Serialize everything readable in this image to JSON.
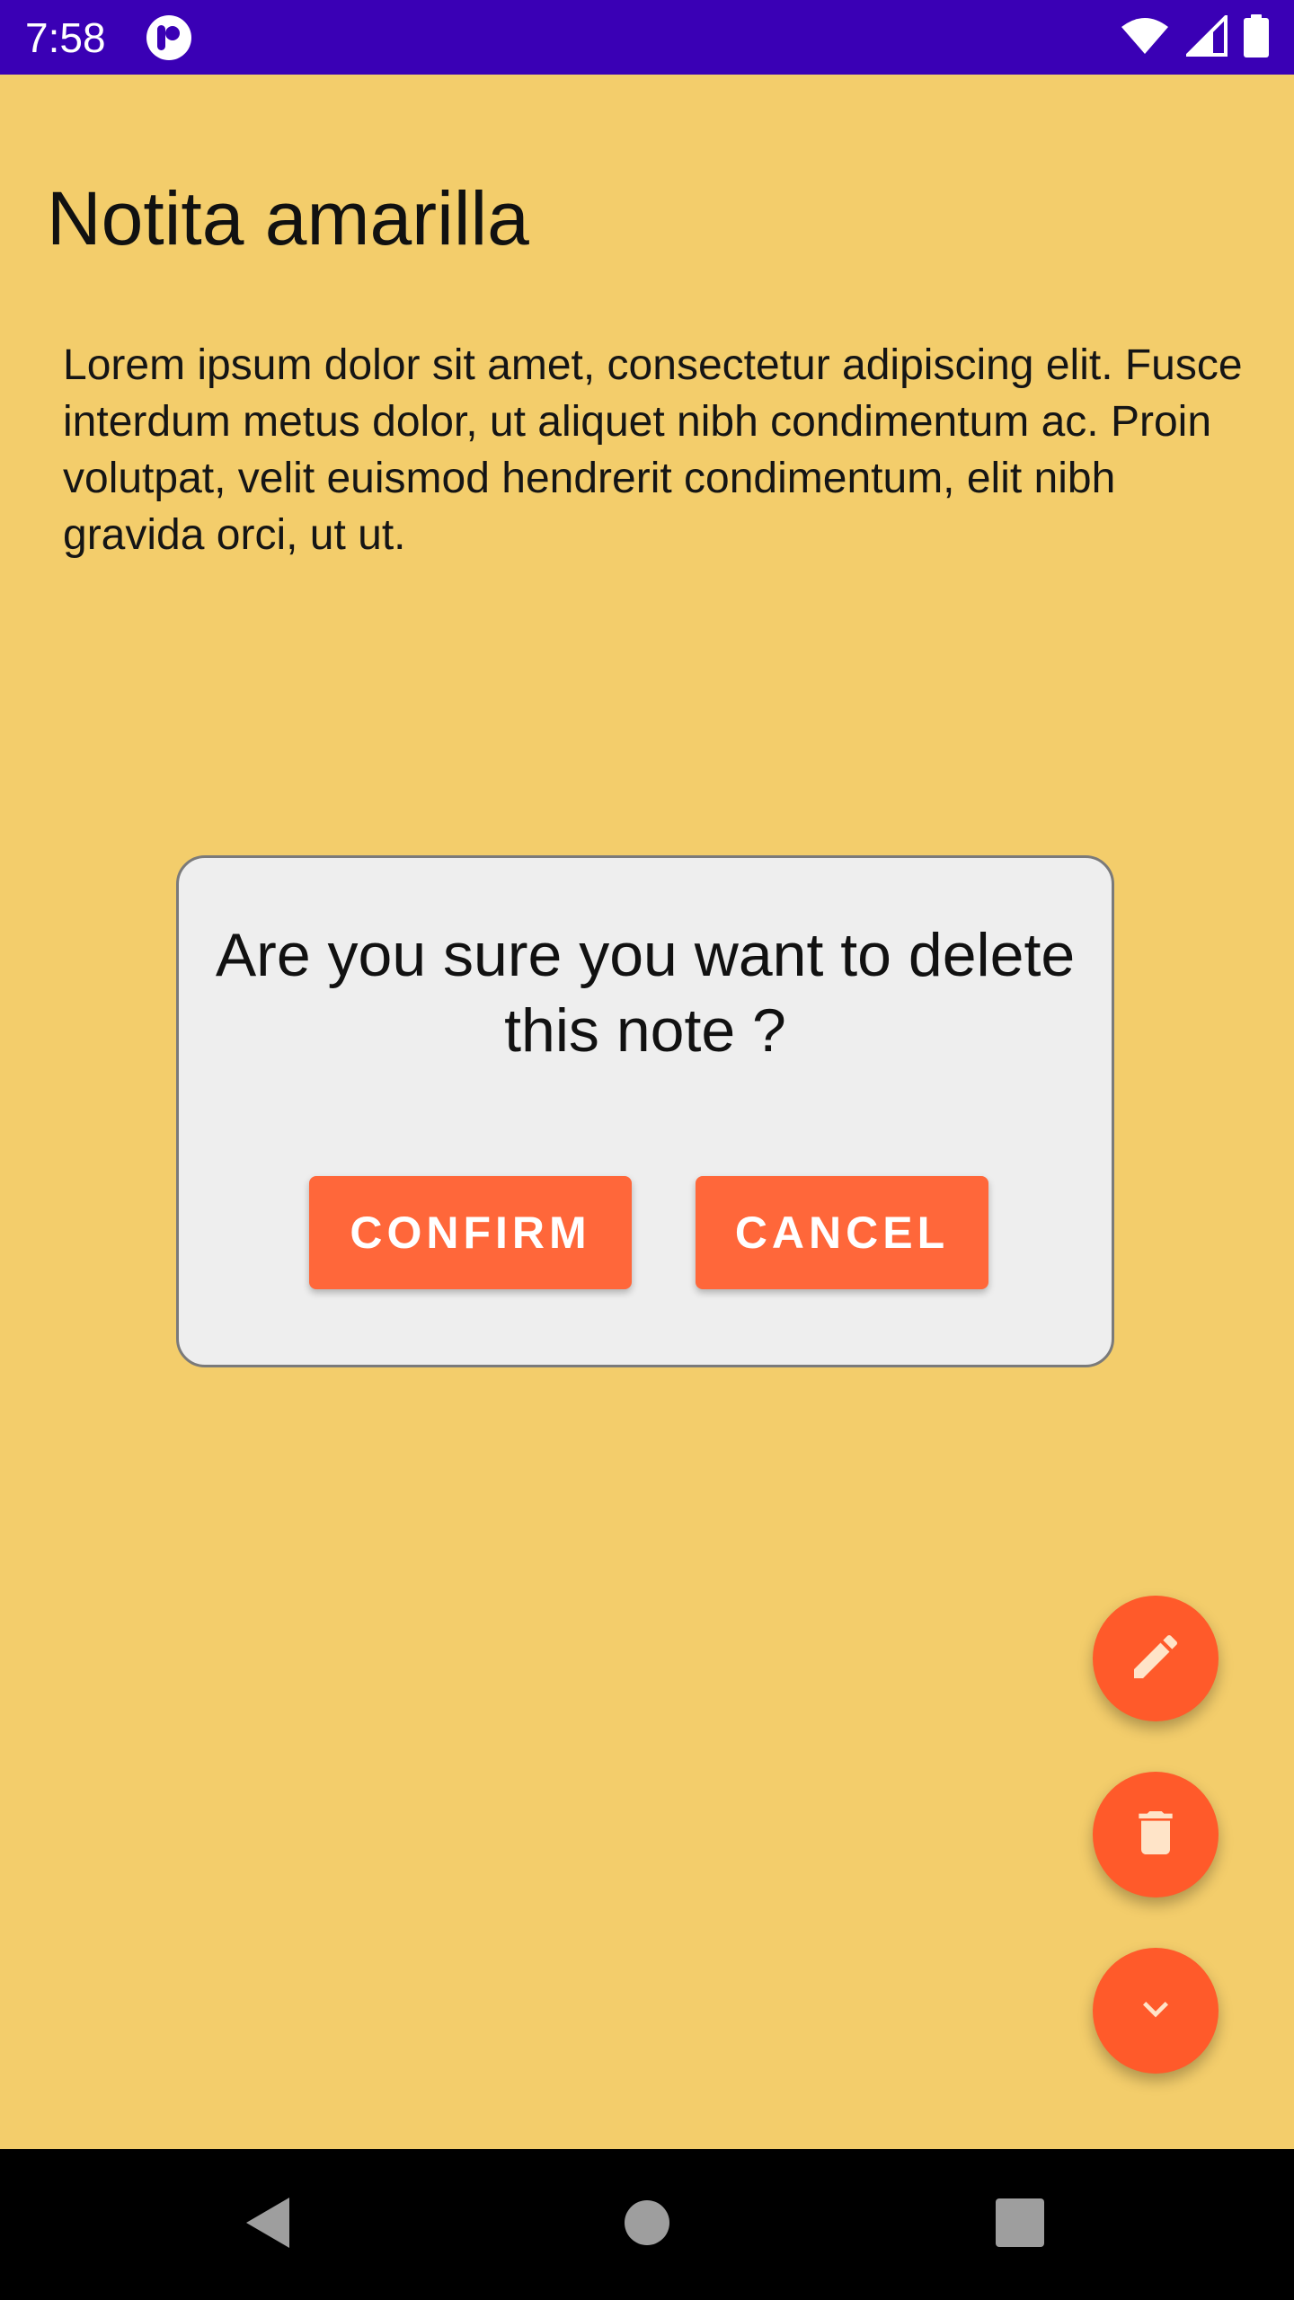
{
  "status_bar": {
    "time": "7:58",
    "background": "#3A00B5",
    "icons": [
      "app-notification-icon",
      "wifi-icon",
      "signal-icon",
      "battery-icon"
    ]
  },
  "note": {
    "title": "Notita amarilla",
    "body": "Lorem ipsum dolor sit amet, consectetur adipiscing elit. Fusce interdum metus dolor, ut aliquet nibh condimentum ac. Proin volutpat, velit euismod hendrerit condimentum, elit nibh gravida orci, ut ut.",
    "background": "#F3CD6B"
  },
  "dialog": {
    "message": "Are you sure you want to delete this note ?",
    "confirm_label": "CONFIRM",
    "cancel_label": "CANCEL",
    "button_color": "#FF673A"
  },
  "fabs": {
    "color": "#FF5A2A",
    "icons": [
      "pencil-icon",
      "trash-icon",
      "chevron-down-icon"
    ]
  },
  "nav_bar": {
    "icons": [
      "back-triangle-icon",
      "home-circle-icon",
      "recents-square-icon"
    ]
  }
}
